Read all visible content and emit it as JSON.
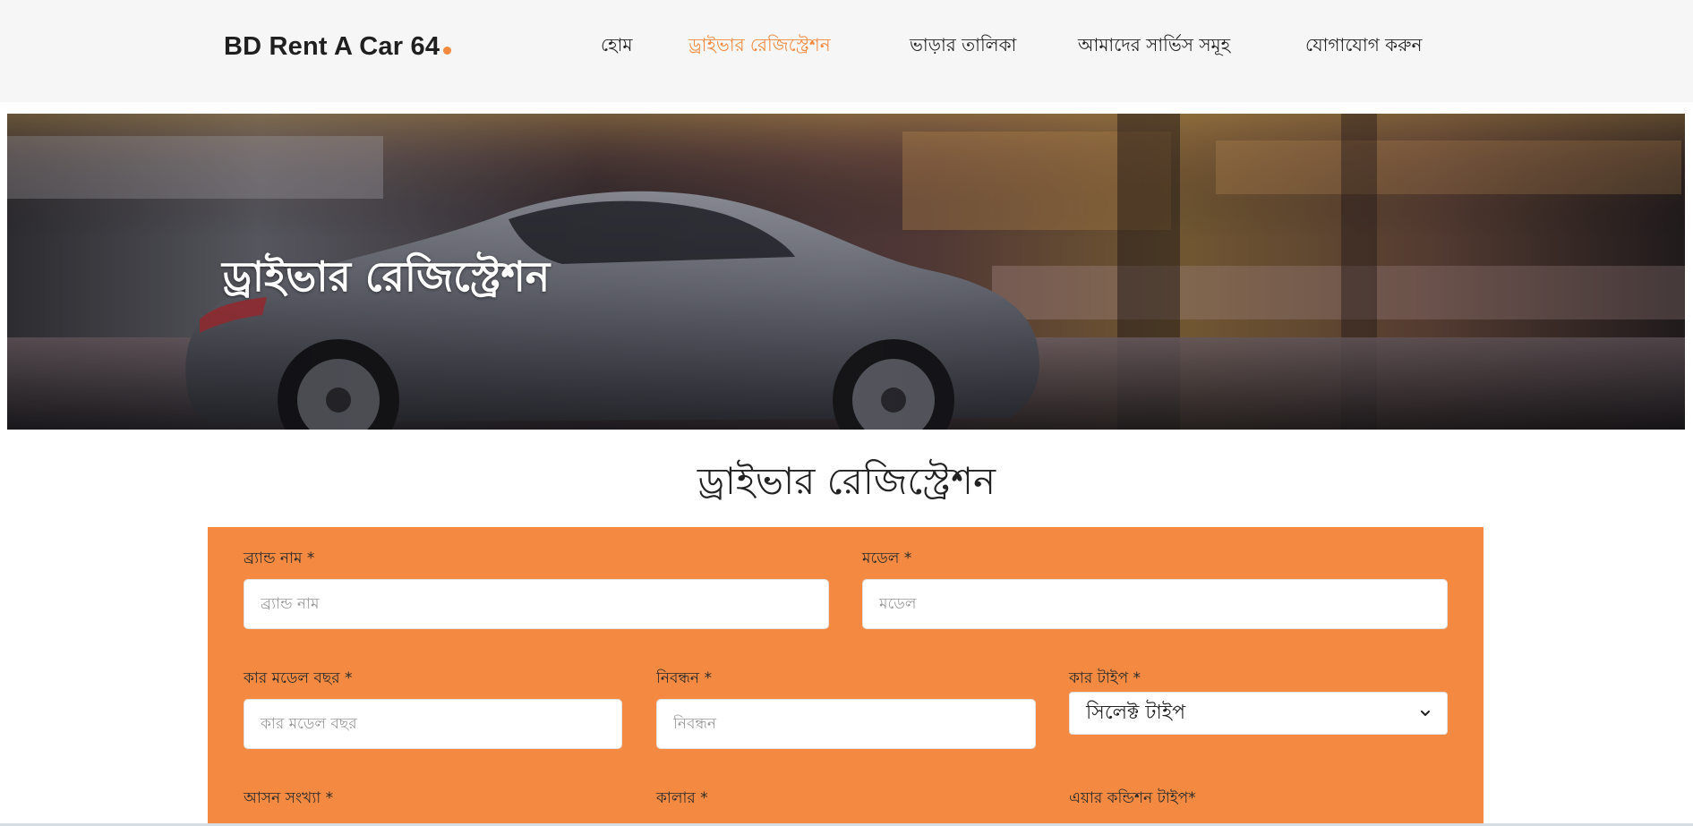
{
  "nav": {
    "brand": "BD Rent A Car 64",
    "links": [
      {
        "label": "হোম",
        "active": false
      },
      {
        "label": "ড্রাইভার রেজিস্ট্রেশন",
        "active": true
      },
      {
        "label": "ভাড়ার তালিকা",
        "active": false
      },
      {
        "label": "আমাদের সার্ভিস সমূহ",
        "active": false
      },
      {
        "label": "যোগাযোগ করুন",
        "active": false
      }
    ]
  },
  "hero": {
    "title": "ড্রাইভার রেজিস্ট্রেশন"
  },
  "section": {
    "title": "ড্রাইভার রেজিস্ট্রেশন"
  },
  "form": {
    "brand_name": {
      "label": "ব্র্যান্ড নাম *",
      "placeholder": "ব্র্যান্ড নাম"
    },
    "model": {
      "label": "মডেল *",
      "placeholder": "মডেল"
    },
    "model_year": {
      "label": "কার মডেল বছর *",
      "placeholder": "কার মডেল বছর"
    },
    "registration": {
      "label": "নিবন্ধন *",
      "placeholder": "নিবন্ধন"
    },
    "car_type": {
      "label": "কার টাইপ *",
      "selected": "সিলেক্ট টাইপ"
    },
    "seat_count": {
      "label": "আসন সংখ্যা *"
    },
    "color": {
      "label": "কালার *"
    },
    "ac_type": {
      "label": "এয়ার কন্ডিশন টাইপ*"
    }
  },
  "colors": {
    "accent": "#f38a3f",
    "form_background": "#f48a41",
    "navbar_background": "#f6f6f6"
  }
}
